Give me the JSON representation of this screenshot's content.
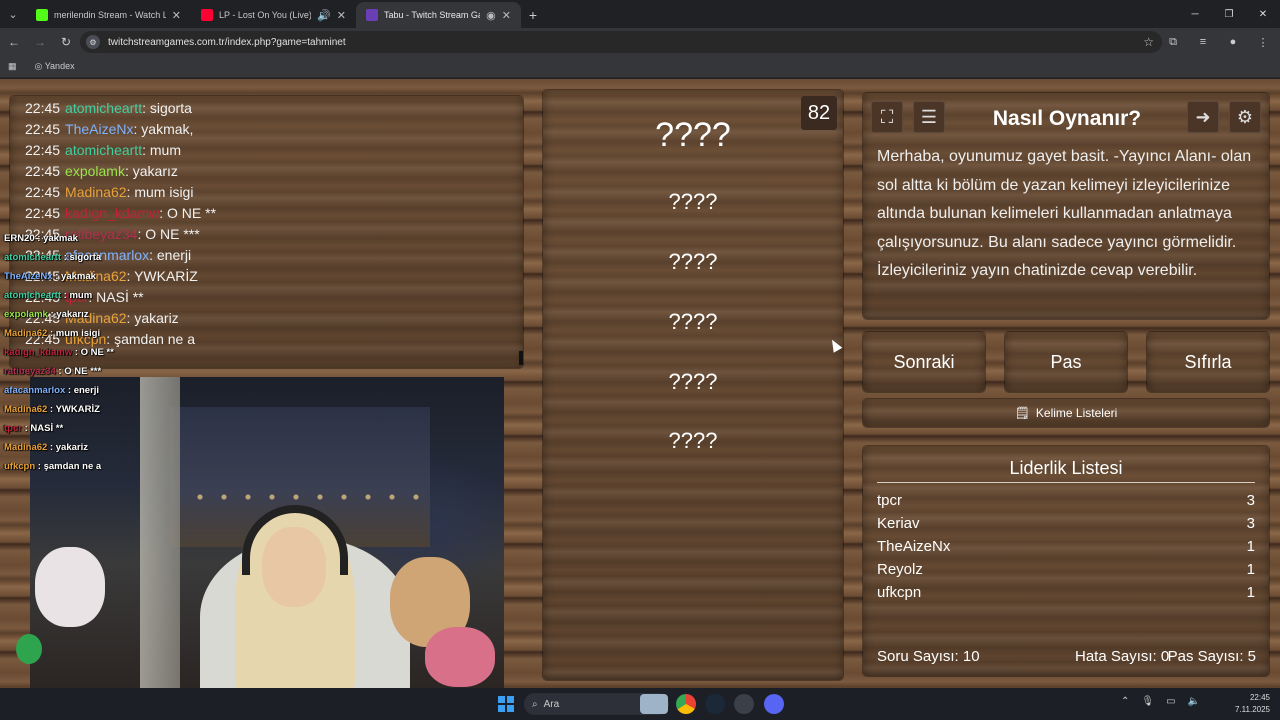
{
  "browser": {
    "tabs": [
      {
        "title": "merilendin Stream - Watch Live",
        "fav_color": "#53fc18"
      },
      {
        "title": "LP - Lost On You (Live) - Yo",
        "fav_color": "#ff0033"
      },
      {
        "title": "Tabu - Twitch Stream Game",
        "fav_color": "#6a3fb5"
      }
    ],
    "url": "twitchstreamgames.com.tr/index.php?game=tahminet",
    "bookmark": "Yandex"
  },
  "chat": [
    {
      "time": "22:45",
      "user": "atomicheartt",
      "user_color": "#40d0a0",
      "msg": "sigorta"
    },
    {
      "time": "22:45",
      "user": "TheAizeNx",
      "user_color": "#7fb2ff",
      "msg": "yakmak,"
    },
    {
      "time": "22:45",
      "user": "atomicheartt",
      "user_color": "#40d0a0",
      "msg": "mum"
    },
    {
      "time": "22:45",
      "user": "expolamk",
      "user_color": "#9be34a",
      "msg": "yakarız"
    },
    {
      "time": "22:45",
      "user": "Madina62",
      "user_color": "#e8a23a",
      "msg": "mum isigi"
    },
    {
      "time": "22:45",
      "user": "kadıgn_kdamw",
      "user_color": "#c0233a",
      "msg": "O NE **"
    },
    {
      "time": "22:45",
      "user": "ratibeyaz34",
      "user_color": "#b03050",
      "msg": "O NE ***"
    },
    {
      "time": "22:45",
      "user": "afacanmarlox",
      "user_color": "#7fb2ff",
      "msg": "enerji"
    },
    {
      "time": "22:45",
      "user": "Madina62",
      "user_color": "#e8a23a",
      "msg": "YWKARİZ"
    },
    {
      "time": "22:45",
      "user": "tpcr",
      "user_color": "#c0233a",
      "msg": "NASİ **"
    },
    {
      "time": "22:45",
      "user": "Madina62",
      "user_color": "#e8a23a",
      "msg": "yakariz"
    },
    {
      "time": "22:45",
      "user": "ufkcpn",
      "user_color": "#e8a23a",
      "msg": "şamdan ne a"
    }
  ],
  "overlay_chat": [
    {
      "user": "ERN20",
      "user_color": "#ffffff",
      "msg": "yakmak"
    },
    {
      "user": "atomicheartt",
      "user_color": "#40d0a0",
      "msg": "sigorta"
    },
    {
      "user": "TheAizeNx",
      "user_color": "#7fb2ff",
      "msg": "yakmak"
    },
    {
      "user": "atomicheartt",
      "user_color": "#40d0a0",
      "msg": "mum"
    },
    {
      "user": "expolamk",
      "user_color": "#9be34a",
      "msg": "yakarız"
    },
    {
      "user": "Madina62",
      "user_color": "#e8a23a",
      "msg": "mum isigi"
    },
    {
      "user": "kadıgn_kdamw",
      "user_color": "#c0233a",
      "msg": "O NE **"
    },
    {
      "user": "ratibeyaz34",
      "user_color": "#b03050",
      "msg": "O NE ***"
    },
    {
      "user": "afacanmarlox",
      "user_color": "#7fb2ff",
      "msg": "enerji"
    },
    {
      "user": "Madina62",
      "user_color": "#e8a23a",
      "msg": "YWKARİZ"
    },
    {
      "user": "tpcr",
      "user_color": "#c0233a",
      "msg": "NASİ **"
    },
    {
      "user": "Madina62",
      "user_color": "#e8a23a",
      "msg": "yakariz"
    },
    {
      "user": "ufkcpn",
      "user_color": "#e8a23a",
      "msg": "şamdan ne a"
    }
  ],
  "game": {
    "counter": "82",
    "main_word": "????",
    "taboo_words": [
      "????",
      "????",
      "????",
      "????",
      "????"
    ]
  },
  "info": {
    "title": "Nasıl Oynanır?",
    "text": "Merhaba, oyunumuz gayet basit. -Yayıncı Alanı- olan sol altta ki bölüm de yazan kelimeyi izleyicilerinize altında bulunan kelimeleri kullanmadan anlatmaya çalışıyorsunuz. Bu alanı sadece yayıncı görmelidir. İzleyicileriniz yayın chatinizde cevap verebilir."
  },
  "buttons": {
    "next": "Sonraki",
    "pass": "Pas",
    "reset": "Sıfırla",
    "word_lists": "Kelime Listeleri"
  },
  "leaderboard": {
    "title": "Liderlik Listesi",
    "rows": [
      {
        "name": "tpcr",
        "score": "3"
      },
      {
        "name": "Keriav",
        "score": "3"
      },
      {
        "name": "TheAizeNx",
        "score": "1"
      },
      {
        "name": "Reyolz",
        "score": "1"
      },
      {
        "name": "ufkcpn",
        "score": "1"
      }
    ],
    "question_count": "Soru Sayısı: 10",
    "error_count": "Hata Sayısı: 0",
    "pass_count": "Pas Sayısı: 5"
  },
  "taskbar": {
    "search": "Ara",
    "time": "22:45",
    "date": "7.11.2025"
  }
}
